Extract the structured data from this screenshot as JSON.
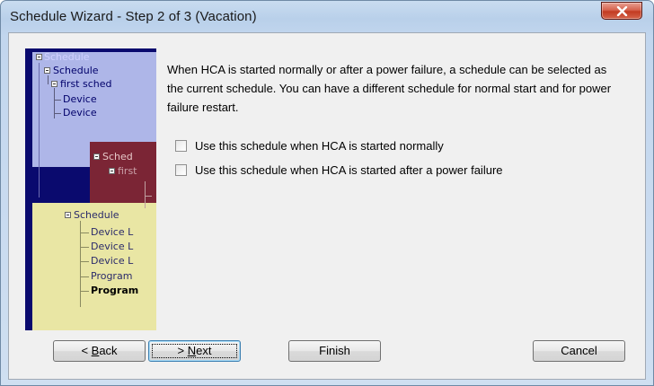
{
  "window": {
    "title": "Schedule Wizard - Step 2 of 3 (Vacation)"
  },
  "illustration": {
    "labels": [
      "Schedule",
      "Schedule",
      "first sched",
      "Device",
      "Device",
      "Sched",
      "first",
      "Schedule",
      "Device L",
      "Device L",
      "Device L",
      "Program",
      "Program"
    ]
  },
  "content": {
    "description": "When HCA is started normally or after a power failure, a schedule can be selected as the current schedule.  You can have a different schedule for normal start and for power failure restart.",
    "checkbox_normal_label": "Use this schedule when HCA is started normally",
    "checkbox_normal_checked": false,
    "checkbox_power_label": "Use this schedule when HCA is started after a power failure",
    "checkbox_power_checked": false
  },
  "buttons": {
    "back_prefix": "< ",
    "back_mnemonic": "B",
    "back_rest": "ack",
    "next_prefix": "> ",
    "next_mnemonic": "N",
    "next_rest": "ext",
    "finish": "Finish",
    "cancel": "Cancel"
  },
  "colors": {
    "accent_blue": "#3c7fb1",
    "close_red": "#c23b22",
    "illustration_background": "#0a0a6e"
  },
  "icons": {
    "close": "close-icon"
  }
}
